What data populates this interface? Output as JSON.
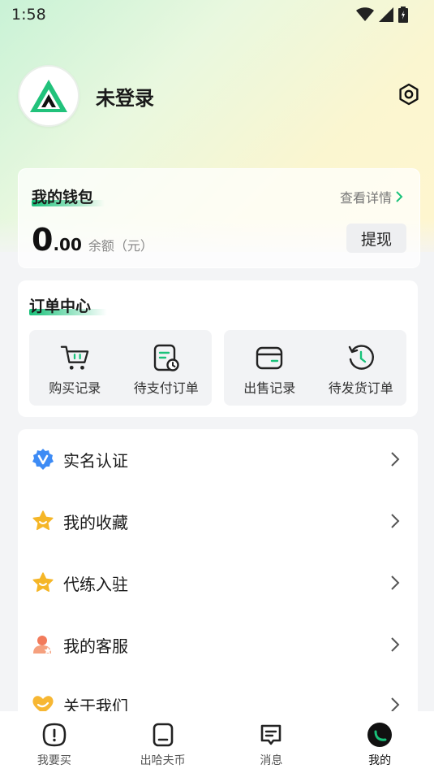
{
  "status_bar": {
    "time": "1:58"
  },
  "profile": {
    "username": "未登录"
  },
  "wallet": {
    "title": "我的钱包",
    "detail_link": "查看详情",
    "balance_int": "0",
    "balance_dec": ".00",
    "balance_label": "余额（元）",
    "withdraw_label": "提现"
  },
  "orders": {
    "title": "订单中心",
    "items": [
      {
        "label": "购买记录",
        "icon": "cart-icon"
      },
      {
        "label": "待支付订单",
        "icon": "pending-payment-icon"
      },
      {
        "label": "出售记录",
        "icon": "wallet-icon"
      },
      {
        "label": "待发货订单",
        "icon": "history-clock-icon"
      }
    ]
  },
  "menu": {
    "items": [
      {
        "label": "实名认证",
        "icon": "verified-badge-icon"
      },
      {
        "label": "我的收藏",
        "icon": "star-icon"
      },
      {
        "label": "代练入驻",
        "icon": "star-icon"
      },
      {
        "label": "我的客服",
        "icon": "customer-service-icon"
      },
      {
        "label": "关于我们",
        "icon": "heart-icon"
      }
    ]
  },
  "tabbar": {
    "items": [
      {
        "label": "我要买",
        "icon": "info-square-icon"
      },
      {
        "label": "出哈夫币",
        "icon": "box-icon"
      },
      {
        "label": "消息",
        "icon": "message-icon"
      },
      {
        "label": "我的",
        "icon": "profile-circle-icon",
        "active": true
      }
    ]
  },
  "colors": {
    "accent": "#19c27a",
    "brand_dark": "#111111"
  }
}
